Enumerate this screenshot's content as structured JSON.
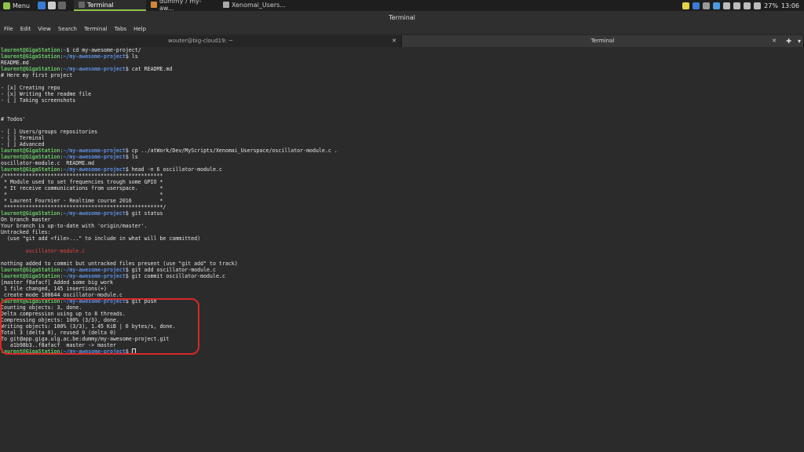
{
  "panel": {
    "menu_label": "Menu",
    "tasks": [
      {
        "label": "Terminal",
        "active": true
      },
      {
        "label": "dummy / my-aw...",
        "active": false
      },
      {
        "label": "Xenomai_Users...",
        "active": false
      }
    ],
    "battery": "27%",
    "clock": "13:06"
  },
  "window": {
    "title": "Terminal"
  },
  "menubar": [
    "File",
    "Edit",
    "View",
    "Search",
    "Terminal",
    "Tabs",
    "Help"
  ],
  "tabs": [
    {
      "label": "wouter@big-cloud19: ~",
      "active": false
    },
    {
      "label": "Terminal",
      "active": true
    }
  ],
  "terminal": {
    "lines": [
      [
        [
          "u",
          "laurent@GigaStation"
        ],
        [
          "t",
          ":"
        ],
        [
          "p",
          "~"
        ],
        [
          "t",
          "$ cd my-awesome-project/"
        ]
      ],
      [
        [
          "u",
          "laurent@GigaStation"
        ],
        [
          "t",
          ":"
        ],
        [
          "p",
          "~/my-awesome-project"
        ],
        [
          "t",
          "$ ls"
        ]
      ],
      [
        [
          "t",
          "README.md"
        ]
      ],
      [
        [
          "u",
          "laurent@GigaStation"
        ],
        [
          "t",
          ":"
        ],
        [
          "p",
          "~/my-awesome-project"
        ],
        [
          "t",
          "$ cat README.md"
        ]
      ],
      [
        [
          "t",
          "# Here my first project"
        ]
      ],
      [
        [
          "t",
          ""
        ]
      ],
      [
        [
          "t",
          "- [x] Creating repo"
        ]
      ],
      [
        [
          "t",
          "- [x] Writing the readme file"
        ]
      ],
      [
        [
          "t",
          "- [ ] Taking screenshots"
        ]
      ],
      [
        [
          "t",
          ""
        ]
      ],
      [
        [
          "t",
          ""
        ]
      ],
      [
        [
          "t",
          "# Todos'"
        ]
      ],
      [
        [
          "t",
          ""
        ]
      ],
      [
        [
          "t",
          "- [ ] Users/groups repositories"
        ]
      ],
      [
        [
          "t",
          "- [ ] Terminal"
        ]
      ],
      [
        [
          "t",
          "- [ ] Advanced"
        ]
      ],
      [
        [
          "u",
          "laurent@GigaStation"
        ],
        [
          "t",
          ":"
        ],
        [
          "p",
          "~/my-awesome-project"
        ],
        [
          "t",
          "$ cp ../atWork/Dev/MyScripts/Xenomai_Userspace/oscillator-module.c ."
        ]
      ],
      [
        [
          "u",
          "laurent@GigaStation"
        ],
        [
          "t",
          ":"
        ],
        [
          "p",
          "~/my-awesome-project"
        ],
        [
          "t",
          "$ ls"
        ]
      ],
      [
        [
          "t",
          "oscillator-module.c  README.md"
        ]
      ],
      [
        [
          "u",
          "laurent@GigaStation"
        ],
        [
          "t",
          ":"
        ],
        [
          "p",
          "~/my-awesome-project"
        ],
        [
          "t",
          "$ head -n 6 oscillator-module.c"
        ]
      ],
      [
        [
          "t",
          "/***************************************************"
        ]
      ],
      [
        [
          "t",
          " * Module used to set frequencies trough some GPIO *"
        ]
      ],
      [
        [
          "t",
          " * It receive communications from userspace.       *"
        ]
      ],
      [
        [
          "t",
          " *                                                 *"
        ]
      ],
      [
        [
          "t",
          " * Laurent Fournier - Realtime course 2016         *"
        ]
      ],
      [
        [
          "t",
          " ***************************************************/"
        ]
      ],
      [
        [
          "u",
          "laurent@GigaStation"
        ],
        [
          "t",
          ":"
        ],
        [
          "p",
          "~/my-awesome-project"
        ],
        [
          "t",
          "$ git status"
        ]
      ],
      [
        [
          "t",
          "On branch master"
        ]
      ],
      [
        [
          "t",
          "Your branch is up-to-date with 'origin/master'."
        ]
      ],
      [
        [
          "t",
          "Untracked files:"
        ]
      ],
      [
        [
          "t",
          "  (use \"git add <file>...\" to include in what will be committed)"
        ]
      ],
      [
        [
          "t",
          ""
        ]
      ],
      [
        [
          "r",
          "        oscillator-module.c"
        ]
      ],
      [
        [
          "t",
          ""
        ]
      ],
      [
        [
          "t",
          "nothing added to commit but untracked files present (use \"git add\" to track)"
        ]
      ],
      [
        [
          "u",
          "laurent@GigaStation"
        ],
        [
          "t",
          ":"
        ],
        [
          "p",
          "~/my-awesome-project"
        ],
        [
          "t",
          "$ git add oscillator-module.c"
        ]
      ],
      [
        [
          "u",
          "laurent@GigaStation"
        ],
        [
          "t",
          ":"
        ],
        [
          "p",
          "~/my-awesome-project"
        ],
        [
          "t",
          "$ git commit oscillator-module.c"
        ]
      ],
      [
        [
          "t",
          "[master f8afacf] Added some big work"
        ]
      ],
      [
        [
          "t",
          " 1 file changed, 145 insertions(+)"
        ]
      ],
      [
        [
          "t",
          " create mode 100644 oscillator-module.c"
        ]
      ],
      [
        [
          "u",
          "laurent@GigaStation"
        ],
        [
          "t",
          ":"
        ],
        [
          "p",
          "~/my-awesome-project"
        ],
        [
          "t",
          "$ git push"
        ]
      ],
      [
        [
          "t",
          "Counting objects: 3, done."
        ]
      ],
      [
        [
          "t",
          "Delta compression using up to 8 threads."
        ]
      ],
      [
        [
          "t",
          "Compressing objects: 100% (3/3), done."
        ]
      ],
      [
        [
          "t",
          "Writing objects: 100% (3/3), 1.45 KiB | 0 bytes/s, done."
        ]
      ],
      [
        [
          "t",
          "Total 3 (delta 0), reused 0 (delta 0)"
        ]
      ],
      [
        [
          "t",
          "To git@app.giga.ulg.ac.be:dummy/my-awesome-project.git"
        ]
      ],
      [
        [
          "t",
          "   a1b98b3..f8afacf  master -> master"
        ]
      ],
      [
        [
          "u",
          "laurent@GigaStation"
        ],
        [
          "t",
          ":"
        ],
        [
          "p",
          "~/my-awesome-project"
        ],
        [
          "t",
          "$ "
        ],
        [
          "c",
          ""
        ]
      ]
    ]
  },
  "colors": {
    "user": "#66c766",
    "path": "#5f8ee0",
    "untracked": "#e04848",
    "highlight": "#d72828",
    "accent": "#8fc34a"
  }
}
